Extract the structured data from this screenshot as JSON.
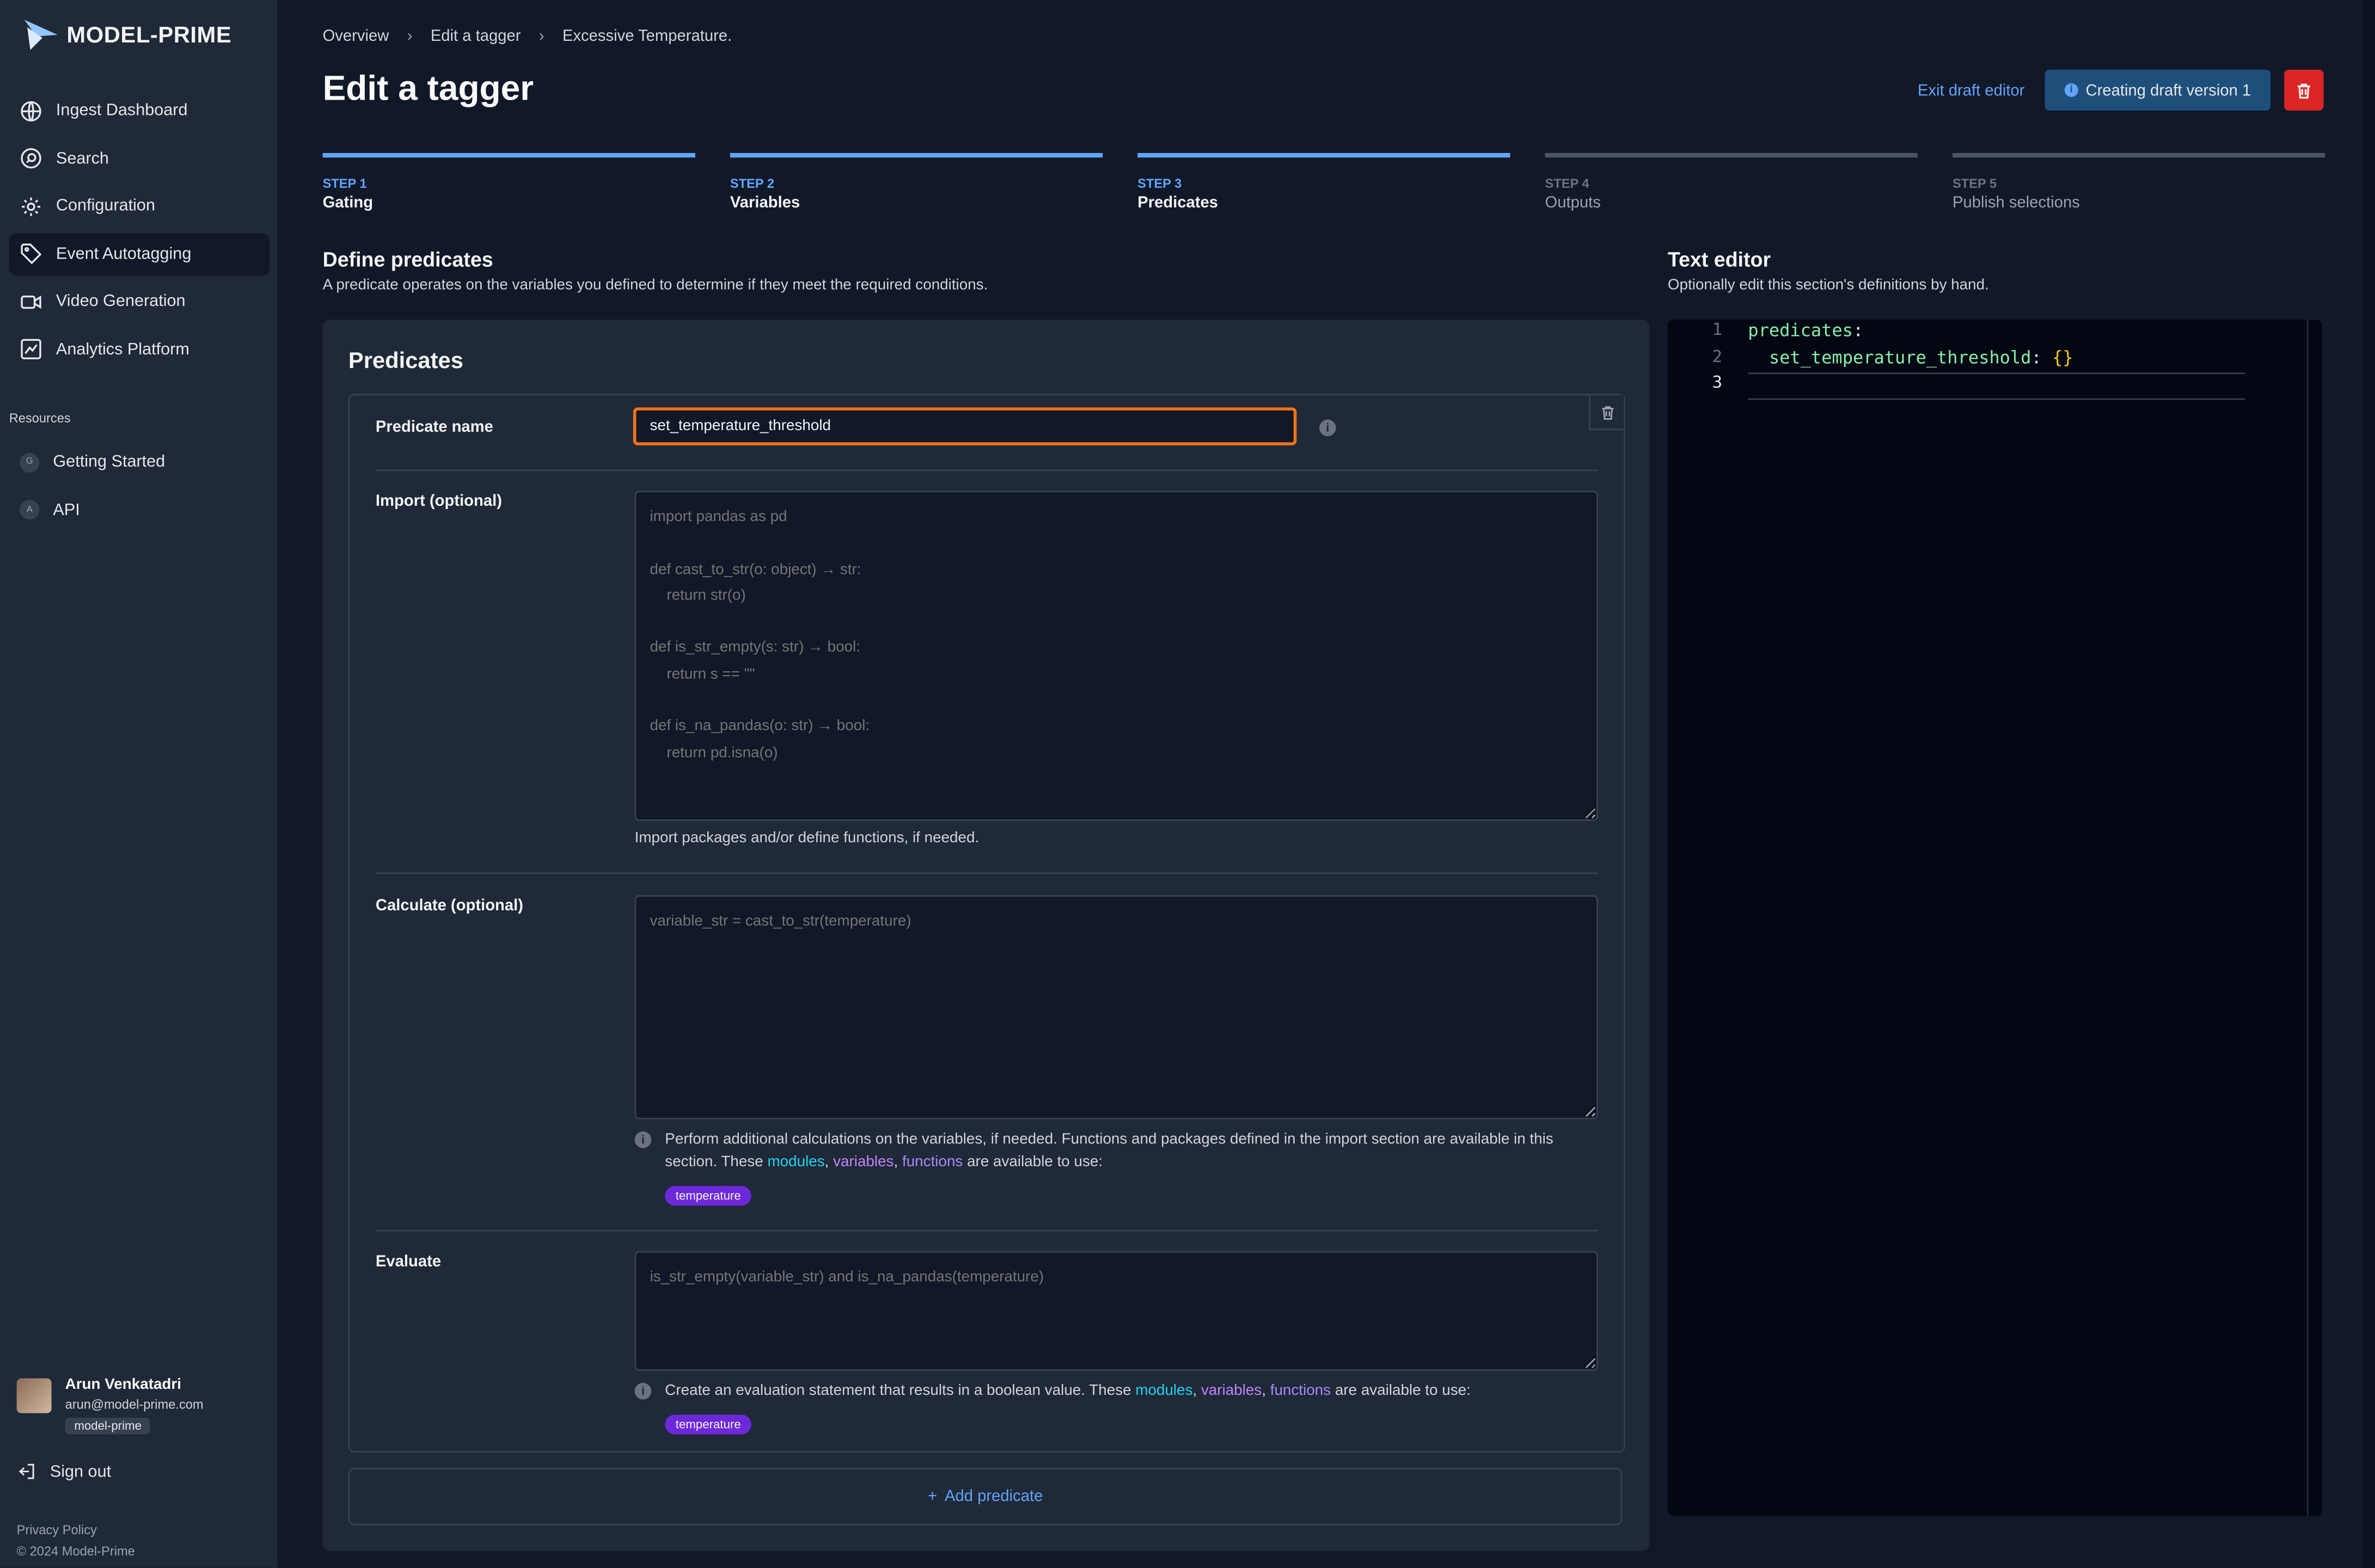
{
  "app": {
    "logo_text": "MODEL-PRIME"
  },
  "sidebar": {
    "items": [
      {
        "label": "Ingest Dashboard",
        "icon": "globe-icon"
      },
      {
        "label": "Search",
        "icon": "search-icon"
      },
      {
        "label": "Configuration",
        "icon": "gear-icon"
      },
      {
        "label": "Event Autotagging",
        "icon": "tag-icon",
        "active": true
      },
      {
        "label": "Video Generation",
        "icon": "video-icon"
      },
      {
        "label": "Analytics Platform",
        "icon": "chart-icon"
      }
    ],
    "resources_title": "Resources",
    "resources": [
      {
        "badge": "G",
        "label": "Getting Started"
      },
      {
        "badge": "A",
        "label": "API"
      }
    ],
    "user": {
      "name": "Arun Venkatadri",
      "email": "arun@model-prime.com",
      "org": "model-prime"
    },
    "signout": "Sign out",
    "footer": {
      "privacy": "Privacy Policy",
      "copyright": "© 2024 Model-Prime"
    }
  },
  "breadcrumbs": [
    "Overview",
    "Edit a tagger",
    "Excessive Temperature."
  ],
  "page_title": "Edit a tagger",
  "header": {
    "exit_draft": "Exit draft editor",
    "draft_status": "Creating draft version 1"
  },
  "steps": [
    {
      "num": "STEP 1",
      "name": "Gating",
      "complete": true
    },
    {
      "num": "STEP 2",
      "name": "Variables",
      "complete": true
    },
    {
      "num": "STEP 3",
      "name": "Predicates",
      "complete": true
    },
    {
      "num": "STEP 4",
      "name": "Outputs",
      "complete": false
    },
    {
      "num": "STEP 5",
      "name": "Publish selections",
      "complete": false
    }
  ],
  "define": {
    "title": "Define predicates",
    "desc": "A predicate operates on the variables you defined to determine if they meet the required conditions."
  },
  "predicates_panel": {
    "title": "Predicates",
    "name_label": "Predicate name",
    "name_value": "set_temperature_threshold",
    "import_label": "Import (optional)",
    "import_placeholder": "import pandas as pd\n\ndef cast_to_str(o: object) → str:\n    return str(o)\n\ndef is_str_empty(s: str) → bool:\n    return s == \"\"\n\ndef is_na_pandas(o: str) → bool:\n    return pd.isna(o)",
    "import_help": "Import packages and/or define functions, if needed.",
    "calculate_label": "Calculate (optional)",
    "calculate_placeholder": "variable_str = cast_to_str(temperature)",
    "calculate_help_pre": "Perform additional calculations on the variables, if needed. Functions and packages defined in the import section are available in this section. These",
    "evaluate_label": "Evaluate",
    "evaluate_placeholder": "is_str_empty(variable_str) and is_na_pandas(temperature)",
    "evaluate_help_pre": "Create an evaluation statement that results in a boolean value. These",
    "modules": "modules",
    "variables": "variables",
    "functions": "functions",
    "help_post": "are available to use:",
    "tag": "temperature",
    "add_predicate": "Add predicate"
  },
  "text_editor": {
    "title": "Text editor",
    "desc": "Optionally edit this section's definitions by hand.",
    "line_numbers": [
      "1",
      "2",
      "3"
    ],
    "line1_key": "predicates",
    "line2_key": "set_temperature_threshold",
    "line2_value": "{}"
  },
  "colors": {
    "accent": "#60a5fa",
    "danger": "#dc2626",
    "focus": "#f97316",
    "tag": "#6d28d9"
  }
}
